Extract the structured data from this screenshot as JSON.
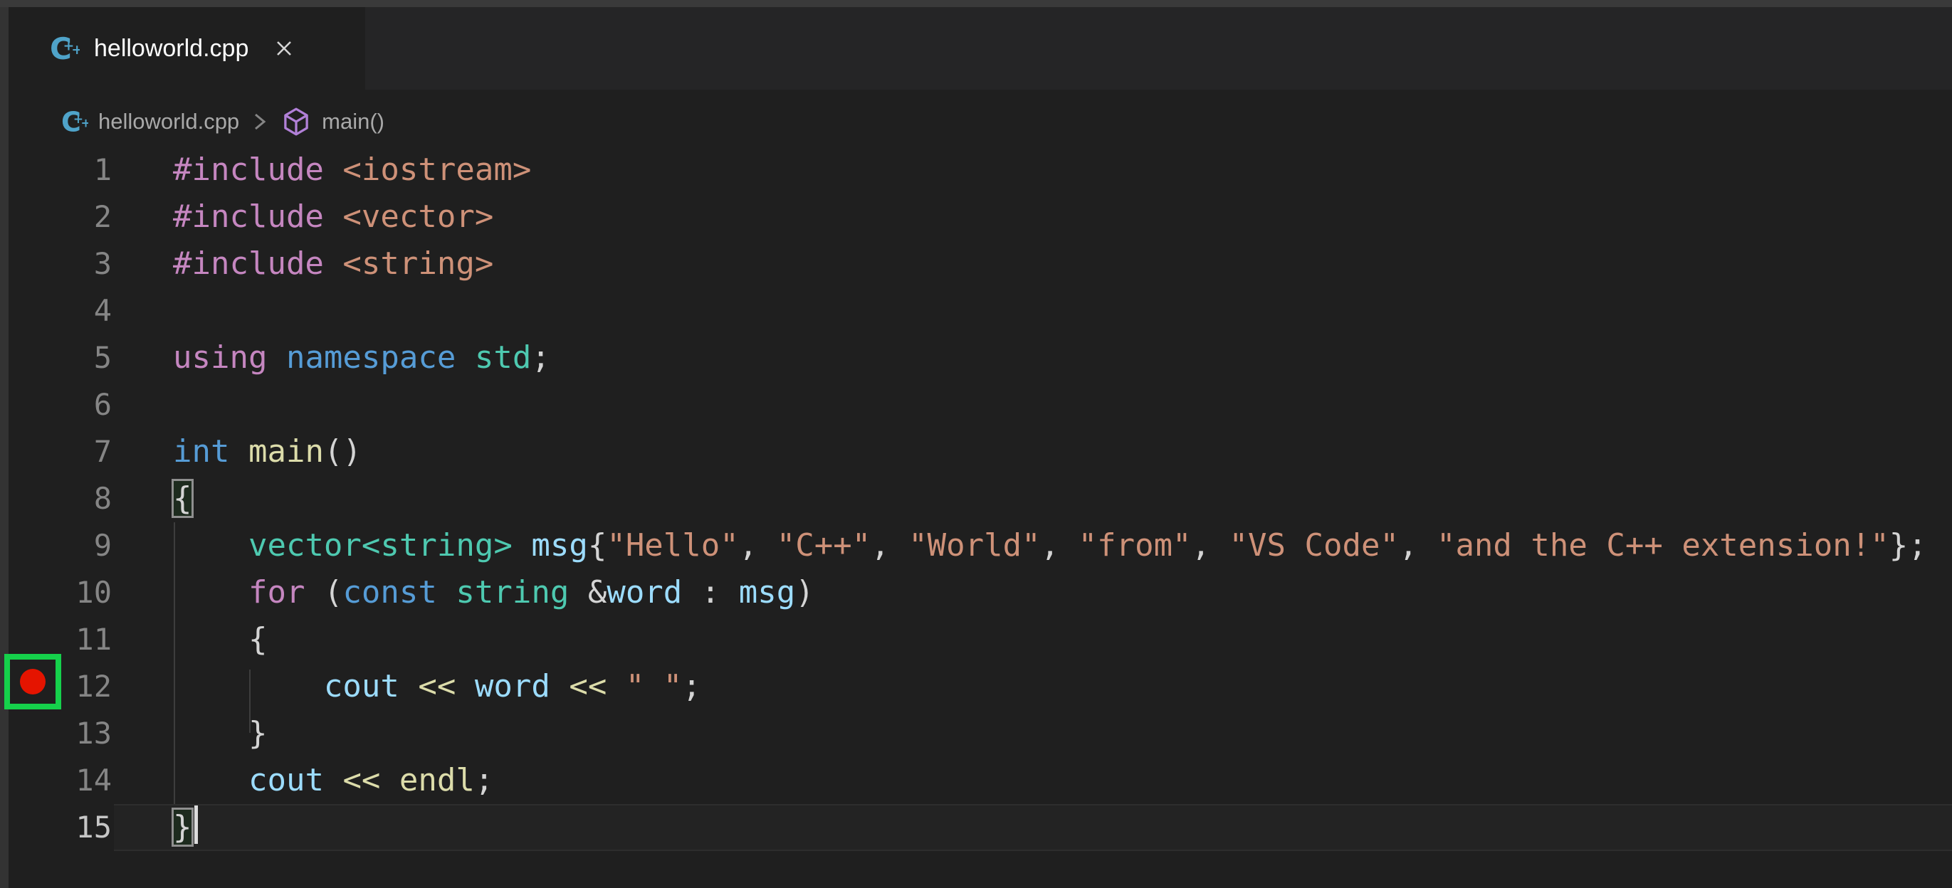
{
  "window": {
    "title": "helloworld.cpp"
  },
  "tab_bar": {
    "active_tab": {
      "label": "helloworld.cpp",
      "icon": "cpp-file-icon",
      "close_icon": "close-icon",
      "state": "active"
    }
  },
  "breadcrumb": {
    "items": [
      {
        "label": "helloworld.cpp",
        "icon": "cpp-file-icon"
      },
      {
        "label": "main()",
        "icon": "symbol-method-icon"
      }
    ]
  },
  "editor": {
    "language": "cpp",
    "total_lines": 15,
    "active_line": 15,
    "breakpoint_line": 12,
    "lines": [
      {
        "n": 1,
        "tokens": [
          [
            "kw",
            "#include"
          ],
          [
            "pl",
            " "
          ],
          [
            "str",
            "<iostream>"
          ]
        ]
      },
      {
        "n": 2,
        "tokens": [
          [
            "kw",
            "#include"
          ],
          [
            "pl",
            " "
          ],
          [
            "str",
            "<vector>"
          ]
        ]
      },
      {
        "n": 3,
        "tokens": [
          [
            "kw",
            "#include"
          ],
          [
            "pl",
            " "
          ],
          [
            "str",
            "<string>"
          ]
        ]
      },
      {
        "n": 4,
        "tokens": []
      },
      {
        "n": 5,
        "tokens": [
          [
            "kw",
            "using"
          ],
          [
            "pl",
            " "
          ],
          [
            "kw2",
            "namespace"
          ],
          [
            "pl",
            " "
          ],
          [
            "type",
            "std"
          ],
          [
            "pl",
            ";"
          ]
        ]
      },
      {
        "n": 6,
        "tokens": []
      },
      {
        "n": 7,
        "tokens": [
          [
            "kw2",
            "int"
          ],
          [
            "pl",
            " "
          ],
          [
            "fn",
            "main"
          ],
          [
            "pl",
            "()"
          ]
        ]
      },
      {
        "n": 8,
        "tokens": [
          [
            "bm",
            "{"
          ]
        ]
      },
      {
        "n": 9,
        "tokens": [
          [
            "pl",
            "    "
          ],
          [
            "type",
            "vector<string>"
          ],
          [
            "pl",
            " "
          ],
          [
            "var",
            "msg"
          ],
          [
            "pl",
            "{"
          ],
          [
            "str",
            "\"Hello\""
          ],
          [
            "pl",
            ", "
          ],
          [
            "str",
            "\"C++\""
          ],
          [
            "pl",
            ", "
          ],
          [
            "str",
            "\"World\""
          ],
          [
            "pl",
            ", "
          ],
          [
            "str",
            "\"from\""
          ],
          [
            "pl",
            ", "
          ],
          [
            "str",
            "\"VS Code\""
          ],
          [
            "pl",
            ", "
          ],
          [
            "str",
            "\"and the C++ extension!\""
          ],
          [
            "pl",
            "};"
          ]
        ]
      },
      {
        "n": 10,
        "tokens": [
          [
            "pl",
            "    "
          ],
          [
            "kw",
            "for"
          ],
          [
            "pl",
            " ("
          ],
          [
            "kw2",
            "const"
          ],
          [
            "pl",
            " "
          ],
          [
            "type",
            "string"
          ],
          [
            "pl",
            " &"
          ],
          [
            "var",
            "word"
          ],
          [
            "pl",
            " : "
          ],
          [
            "var",
            "msg"
          ],
          [
            "pl",
            ")"
          ]
        ]
      },
      {
        "n": 11,
        "tokens": [
          [
            "pl",
            "    "
          ],
          [
            "pl",
            "{"
          ]
        ]
      },
      {
        "n": 12,
        "tokens": [
          [
            "pl",
            "        "
          ],
          [
            "var",
            "cout"
          ],
          [
            "pl",
            " "
          ],
          [
            "fn",
            "<<"
          ],
          [
            "pl",
            " "
          ],
          [
            "var",
            "word"
          ],
          [
            "pl",
            " "
          ],
          [
            "fn",
            "<<"
          ],
          [
            "pl",
            " "
          ],
          [
            "str",
            "\" \""
          ],
          [
            "pl",
            ";"
          ]
        ]
      },
      {
        "n": 13,
        "tokens": [
          [
            "pl",
            "    "
          ],
          [
            "pl",
            "}"
          ]
        ]
      },
      {
        "n": 14,
        "tokens": [
          [
            "pl",
            "    "
          ],
          [
            "var",
            "cout"
          ],
          [
            "pl",
            " "
          ],
          [
            "fn",
            "<<"
          ],
          [
            "pl",
            " "
          ],
          [
            "fn",
            "endl"
          ],
          [
            "pl",
            ";"
          ]
        ]
      },
      {
        "n": 15,
        "tokens": [
          [
            "bm",
            "}"
          ]
        ],
        "cursor": true
      }
    ]
  },
  "colors": {
    "editor_background": "#1f1f1f",
    "tabbar_background": "#252526",
    "activity_strip": "#333333",
    "title_strip": "#3a3a3a",
    "breakpoint_red": "#E51400",
    "breakpoint_highlight_green": "#15D14B",
    "keyword_pink": "#C586C0",
    "keyword_blue": "#569CD6",
    "type_teal": "#4EC9B0",
    "function_yellow": "#DCDCAA",
    "variable_blue": "#9CDCFE",
    "string_orange": "#CE9178",
    "cpp_icon_blue": "#4FA3C9",
    "symbol_icon_purple": "#B180D7",
    "line_number_gray": "#858585"
  }
}
